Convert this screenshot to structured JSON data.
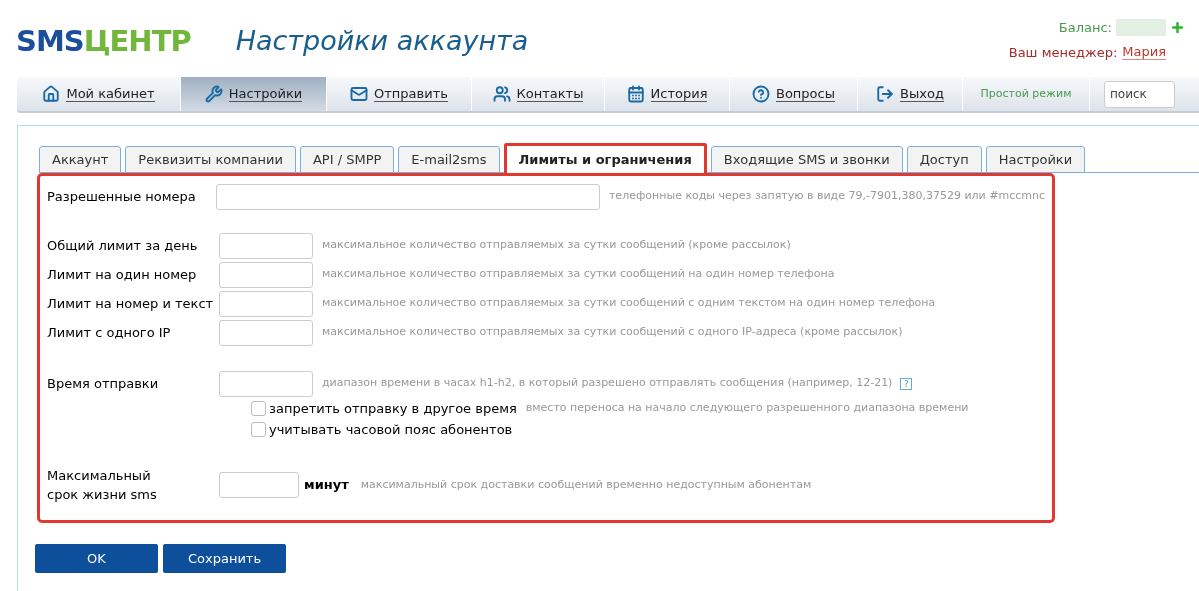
{
  "logo": {
    "primary": "SMS",
    "accent": "ЦЕНТР"
  },
  "page_title": "Настройки аккаунта",
  "account": {
    "balance_label": "Баланс:",
    "manager_label": "Ваш менеджер:",
    "manager_name": "Мария"
  },
  "nav": [
    {
      "label": "Мой кабинет",
      "kind": "home",
      "selected": false
    },
    {
      "label": "Настройки",
      "kind": "tools",
      "selected": true
    },
    {
      "label": "Отправить",
      "kind": "mail",
      "selected": false
    },
    {
      "label": "Контакты",
      "kind": "users",
      "selected": false
    },
    {
      "label": "История",
      "kind": "calendar",
      "selected": false
    },
    {
      "label": "Вопросы",
      "kind": "question",
      "selected": false
    },
    {
      "label": "Выход",
      "kind": "exit",
      "selected": false
    }
  ],
  "simple_mode": "Простой режим",
  "search": {
    "placeholder": "поиск"
  },
  "tabs": [
    {
      "label": "Аккаунт",
      "selected": false
    },
    {
      "label": "Реквизиты компании",
      "selected": false
    },
    {
      "label": "API / SMPP",
      "selected": false
    },
    {
      "label": "E-mail2sms",
      "selected": false
    },
    {
      "label": "Лимиты и ограничения",
      "selected": true
    },
    {
      "label": "Входящие SMS и звонки",
      "selected": false
    },
    {
      "label": "Доступ",
      "selected": false
    },
    {
      "label": "Настройки",
      "selected": false
    }
  ],
  "groups": [
    [
      {
        "kind": "wide",
        "label": "Разрешенные номера",
        "hint": "телефонные коды через запятую в виде 79,-7901,380,37529 или #mccmnc"
      }
    ],
    [
      {
        "kind": "short",
        "label": "Общий лимит за день",
        "hint": "максимальное количество отправляемых за сутки сообщений (кроме рассылок)"
      },
      {
        "kind": "short",
        "label": "Лимит на один номер",
        "hint": "максимальное количество отправляемых за сутки сообщений на один номер телефона"
      },
      {
        "kind": "short",
        "label": "Лимит на номер и текст",
        "hint": "максимальное количество отправляемых за сутки сообщений с одним текстом на один номер телефона"
      },
      {
        "kind": "short",
        "label": "Лимит с одного IP",
        "hint": "максимальное количество отправляемых за сутки сообщений с одного IP-адреса (кроме рассылок)"
      }
    ],
    [
      {
        "kind": "short",
        "label": "Время отправки",
        "hint": "диапазон времени в часах h1-h2, в который разрешено отправлять сообщения (например, 12-21)",
        "help": "?"
      },
      {
        "kind": "checkbox",
        "label": "запретить отправку в другое время",
        "checked": false,
        "hint": "вместо переноса на начало следующего разрешенного диапазона времени"
      },
      {
        "kind": "checkbox",
        "label": "учитывать часовой пояс абонентов",
        "checked": false
      }
    ],
    [
      {
        "kind": "unit",
        "label": "Максимальный срок жизни sms",
        "unit": "минут",
        "hint": "максимальный срок доставки сообщений временно недоступным абонентам"
      }
    ]
  ],
  "buttons": [
    "OK",
    "Сохранить"
  ]
}
